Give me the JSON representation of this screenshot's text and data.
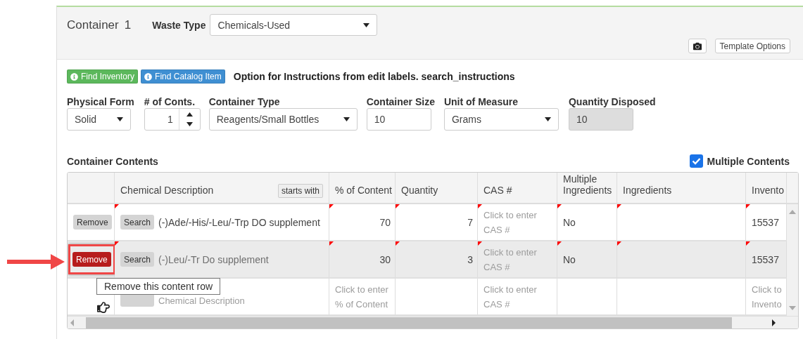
{
  "container": {
    "label": "Container",
    "number": "1",
    "waste_type": {
      "label": "Waste Type",
      "value": "Chemicals-Used"
    },
    "template_button": "Template Options"
  },
  "find_buttons": [
    {
      "label": "Find Inventory",
      "color": "#5cb85c"
    },
    {
      "label": "Find Catalog Item",
      "color": "#3f8fd2"
    }
  ],
  "instructions": "Option for Instructions from edit labels. search_instructions",
  "fields": [
    {
      "kind": "select",
      "label": "Physical Form",
      "value": "Solid",
      "disabled": false
    },
    {
      "kind": "spinner",
      "label": "# of Conts.",
      "value": "1",
      "disabled": false
    },
    {
      "kind": "select",
      "label": "Container Type",
      "value": "Reagents/Small Bottles",
      "disabled": false
    },
    {
      "kind": "input",
      "label": "Container Size",
      "value": "10",
      "disabled": false
    },
    {
      "kind": "select",
      "label": "Unit of Measure",
      "value": "Grams",
      "disabled": false
    },
    {
      "kind": "input",
      "label": "Quantity Disposed",
      "value": "10",
      "disabled": true
    }
  ],
  "contents": {
    "label": "Container Contents",
    "multiple": {
      "label": "Multiple Contents",
      "checked": true
    },
    "filter_button": "starts with",
    "columns": [
      "Chemical Description",
      "% of Content",
      "Quantity",
      "CAS #",
      "Multiple Ingredients",
      "Ingredients",
      "Invento"
    ],
    "rows": [
      {
        "kind": "entry",
        "selected": false,
        "highlighted": false,
        "modified": true,
        "remove": "Remove",
        "search": "Search",
        "description": {
          "value": "(-)Ade/-His/-Leu/-Trp DO supplement"
        },
        "percent": {
          "value": "70"
        },
        "quantity": {
          "value": "7"
        },
        "cas": {
          "placeholder": "Click to enter CAS #"
        },
        "multiple_ingredients": {
          "value": "No"
        },
        "inventory": {
          "value": "15537"
        }
      },
      {
        "kind": "entry",
        "selected": true,
        "highlighted": true,
        "modified": true,
        "remove": "Remove",
        "search": "Search",
        "description": {
          "value": "(-)Leu/-Tr Do supplement"
        },
        "percent": {
          "value": "30"
        },
        "quantity": {
          "value": "3"
        },
        "cas": {
          "placeholder": "Click to enter CAS #"
        },
        "multiple_ingredients": {
          "value": "No"
        },
        "inventory": {
          "value": "15537"
        }
      },
      {
        "kind": "new",
        "selected": false,
        "modified": false,
        "description": {
          "placeholder": "Chemical Description"
        },
        "percent": {
          "placeholder": "Click to enter % of Content"
        },
        "cas": {
          "placeholder": "Click to enter CAS #"
        },
        "inventory": {
          "placeholder": "Click to Invento"
        }
      }
    ],
    "tooltip": "Remove this content row"
  }
}
